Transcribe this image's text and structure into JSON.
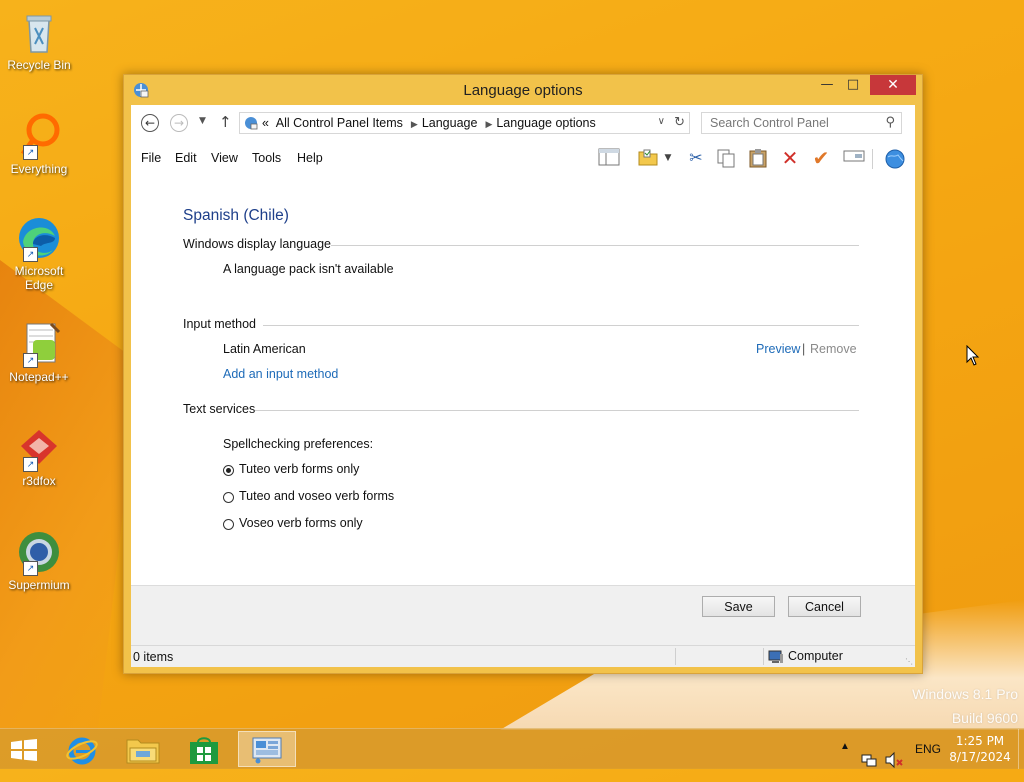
{
  "desktop": {
    "icons": [
      {
        "label": "Recycle Bin"
      },
      {
        "label": "Everything"
      },
      {
        "label": "Microsoft Edge"
      },
      {
        "label": "Notepad++"
      },
      {
        "label": "r3dfox"
      },
      {
        "label": "Supermium"
      }
    ],
    "watermark": {
      "line1": "Windows 8.1 Pro",
      "line2": "Build 9600"
    }
  },
  "window": {
    "title": "Language options",
    "address": {
      "prefix": "«",
      "crumbs": [
        "All Control Panel Items",
        "Language",
        "Language options"
      ]
    },
    "search": {
      "placeholder": "Search Control Panel"
    },
    "menu": [
      "File",
      "Edit",
      "View",
      "Tools",
      "Help"
    ],
    "language_name": "Spanish (Chile)",
    "sections": {
      "display": {
        "heading": "Windows display language",
        "status": "A language pack isn't available"
      },
      "input": {
        "heading": "Input method",
        "method": "Latin American",
        "preview": "Preview",
        "separator": "|",
        "remove": "Remove",
        "add": "Add an input method"
      },
      "text_services": {
        "heading": "Text services",
        "spell_label": "Spellchecking preferences:",
        "options": [
          "Tuteo verb forms only",
          "Tuteo and voseo verb forms",
          "Voseo verb forms only"
        ],
        "selected_index": 0
      }
    },
    "buttons": {
      "save": "Save",
      "cancel": "Cancel"
    },
    "status": {
      "items": "0 items",
      "location": "Computer"
    }
  },
  "taskbar": {
    "tray_lang": "ENG",
    "clock_time": "1:25 PM",
    "clock_date": "8/17/2024"
  },
  "colors": {
    "accent_link": "#1e6bb8",
    "title_blue": "#1e3f8a",
    "close_red": "#c7373a",
    "wallpaper": "#f5a712"
  }
}
